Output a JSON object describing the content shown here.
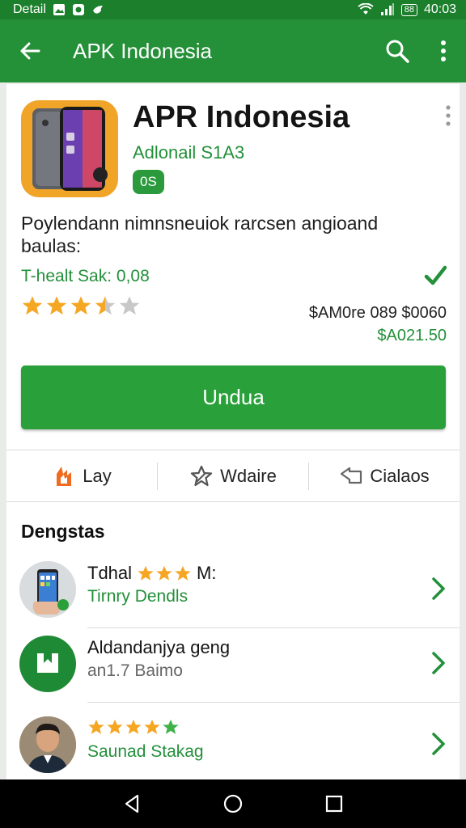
{
  "status_bar": {
    "left_label": "Detail",
    "time": "40:03",
    "battery": "88"
  },
  "app_bar": {
    "title": "APK Indonesia"
  },
  "app": {
    "name": "APR Indonesia",
    "developer": "Adlonail S1A3",
    "badge": "0S",
    "description": "Poylendann nimnsneuiok rarcsen angioand baulas:",
    "meta": "T-healt  Sak: 0,08",
    "rating": 3.5,
    "price_old": "$AM0re 089 $0060",
    "price_new": "$A021.50",
    "download_label": "Undua"
  },
  "actions": [
    {
      "label": "Lay",
      "icon": "flame-icon"
    },
    {
      "label": "Wdaire",
      "icon": "star-outline-icon"
    },
    {
      "label": "Cialaos",
      "icon": "share-icon"
    }
  ],
  "section": {
    "title": "Dengstas"
  },
  "list": [
    {
      "line1": "Tdhal",
      "line1_suffix": "M:",
      "line2": "Tirnry Dendls",
      "stars": 3
    },
    {
      "line1": "Aldandanjya geng",
      "line2": "an1.7 Baimo"
    },
    {
      "line2": "Saunad Stakag",
      "stars": 5
    }
  ],
  "colors": {
    "primary": "#249038",
    "accent": "#2aa03a",
    "star": "#f5a623"
  }
}
